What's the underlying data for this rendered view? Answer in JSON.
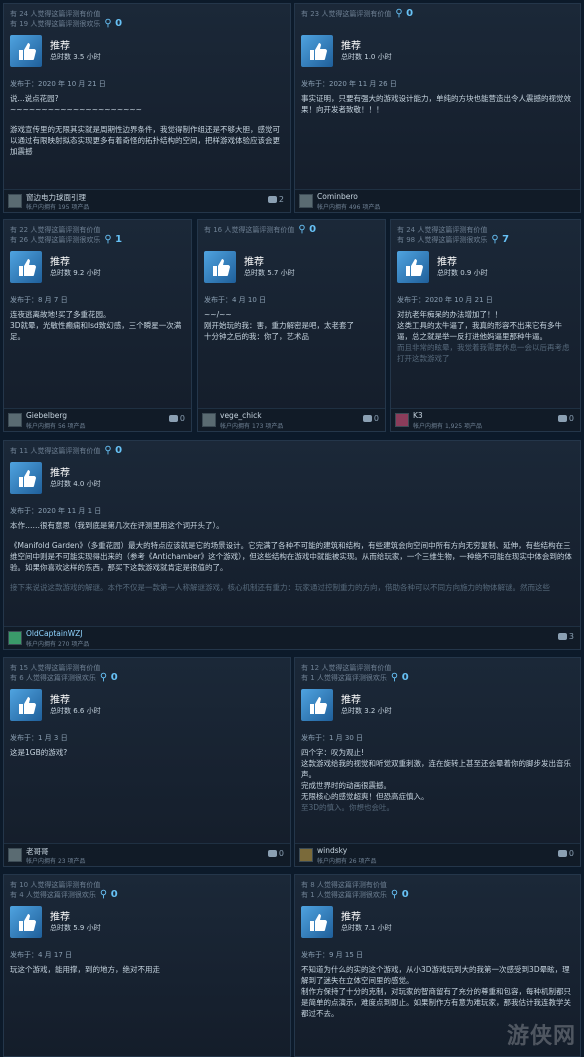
{
  "common": {
    "recommended": "推荐",
    "posted_prefix": "发布于：",
    "hours_prefix": "总时数",
    "hours_suffix": "小时",
    "products_suffix": "项产品",
    "products_prefix": "帐户内拥有"
  },
  "reviews": [
    {
      "helpful": "有 24 人觉得这篇评测有价值",
      "funny": "有 19 人觉得这篇评测很欢乐",
      "award": "0",
      "hours": "3.5",
      "date": "2020 年 10 月 21 日",
      "body": [
        "说...说点花园?",
        "~~~~~~~~~~~~~~~~~~~~~",
        "游戏宣传里的无限其实就是周期性边界条件，我觉得制作组还是不够大胆，感觉可以通过有限映射拟态实现更多有着奇怪的拓扑结构的空间，把样游戏体验应该会更加震撼"
      ],
      "author": "窗边电力球面引理",
      "products": "195",
      "comments": "2"
    },
    {
      "helpful": "有 23 人觉得这篇评测有价值",
      "funny": "",
      "award": "0",
      "hours": "1.0",
      "date": "2020 年 11 月 26 日",
      "body": [
        "事实证明，只要有强大的游戏设计能力，单纯的方块也能营造出令人震撼的视觉效果！向开发者致敬！！！"
      ],
      "author": "Cominbero",
      "products": "496",
      "comments": ""
    },
    {
      "helpful": "有 22 人觉得这篇评测有价值",
      "funny": "有 26 人觉得这篇评测很欢乐",
      "award": "1",
      "hours": "9.2",
      "date": "8 月 7 日",
      "body": [
        "连夜逃离故地!买了多重花园。",
        "3D就晕，光敏性癫痫和lsd致幻感，三个瞬星一次满足。"
      ],
      "author": "Giebelberg",
      "products": "56",
      "comments": "0"
    },
    {
      "helpful": "有 16 人觉得这篇评测有价值",
      "funny": "",
      "award": "0",
      "hours": "5.7",
      "date": "4 月 10 日",
      "body": [
        "~~/~~",
        "刚开始玩的我：害，重力解密是吧，太老套了",
        "十分钟之后的我：你了，艺术品"
      ],
      "author": "vege_chick",
      "products": "173",
      "comments": "0"
    },
    {
      "helpful": "有 24 人觉得这篇评测有价值",
      "funny": "有 98 人觉得这篇评测很欢乐",
      "award": "7",
      "hours": "0.9",
      "date": "2020 年 10 月 21 日",
      "body": [
        "对抗老年痴呆的办法增加了！！",
        "这类工具的太牛逼了，我真的形容不出来它有多牛逼，总之就是举一反打进他妈逼里那种牛逼。",
        "而且非常的眩晕，我觉着我需要休息一会以后再考虑打开这款游戏了"
      ],
      "author": "K3",
      "products": "1,925",
      "comments": "0"
    },
    {
      "helpful": "有 11 人觉得这篇评测有价值",
      "funny": "",
      "award": "0",
      "hours": "4.0",
      "date": "2020 年 11 月 1 日",
      "body": [
        "本作……很有意思（我到底是第几次在评测里用这个词开头了）。",
        "《Manifold Garden》（多重花园）最大的特点应该就是它的场景设计。它完满了各种不可能的建筑和结构，有些建筑会向空间中所有方向无穷复制、延伸，有些结构在三维空间中则是不可能实现得出来的（参考《Antichamber》这个游戏），但这些结构在游戏中就能被实现。从而给玩家，一个三维生物，一种绝不可能在现实中体会到的体验。如果你喜欢这样的东西，那买下这款游戏就肯定是很值的了。",
        "接下来说说这款游戏的解谜。本作不仅是一款第一人称解谜游戏，核心机制还有重力：玩家通过控制重力的方向，借助各种可以不同方向施力的物体解谜。然而这些"
      ],
      "author": "OldCaptainWZJ",
      "products": "270",
      "comments": "3"
    },
    {
      "helpful": "有 15 人觉得这篇评测有价值",
      "funny": "有 6 人觉得这篇评测很欢乐",
      "award": "0",
      "hours": "6.6",
      "date": "1 月 3 日",
      "body": [
        "这是1GB的游戏?"
      ],
      "author": "老哥哥",
      "products": "23",
      "comments": "0"
    },
    {
      "helpful": "有 12 人觉得这篇评测有价值",
      "funny": "有 1 人觉得这篇评测很欢乐",
      "award": "0",
      "hours": "3.2",
      "date": "1 月 30 日",
      "body": [
        "四个字：叹为观止!",
        "这款游戏给我的视觉和听觉双重刺激，连在旋转上甚至还会晕着你的脚步发出音乐声。",
        "完成世界时的动画很震撼。",
        "无限核心的感觉超爽！但恐高症慎入。",
        "至3D的慎入。你想也会吐。"
      ],
      "author": "windsky",
      "products": "26",
      "comments": "0"
    },
    {
      "helpful": "有 10 人觉得这篇评测有价值",
      "funny": "有 4 人觉得这篇评测很欢乐",
      "award": "0",
      "hours": "5.9",
      "date": "4 月 17 日",
      "body": [
        "玩这个游戏，能用撑，到的地方，绝对不用走"
      ],
      "author": "",
      "products": "",
      "comments": ""
    },
    {
      "helpful": "有 8 人觉得这篇评测有价值",
      "funny": "有 1 人觉得这篇评测很欢乐",
      "award": "0",
      "hours": "7.1",
      "date": "9 月 15 日",
      "body": [
        "不知道为什么的实的这个游戏，从小3D游戏玩到大的我第一次感受到3D晕眩，理解到了迷失在立体空间里的感觉。",
        "制作方保持了十分的克制，对玩家的智商留有了充分的尊重和包容，每种机制都只是简单的点演示，难度点到即止。如果制作方有意为难玩家，那我估计我连教学关都过不去。"
      ],
      "author": "",
      "products": "",
      "comments": ""
    }
  ],
  "watermark": "游侠网",
  "colors": {
    "background": "#0c1a2a",
    "card": "#16202d",
    "accent": "#67c1f5",
    "thumb": "#2f7bbd"
  }
}
